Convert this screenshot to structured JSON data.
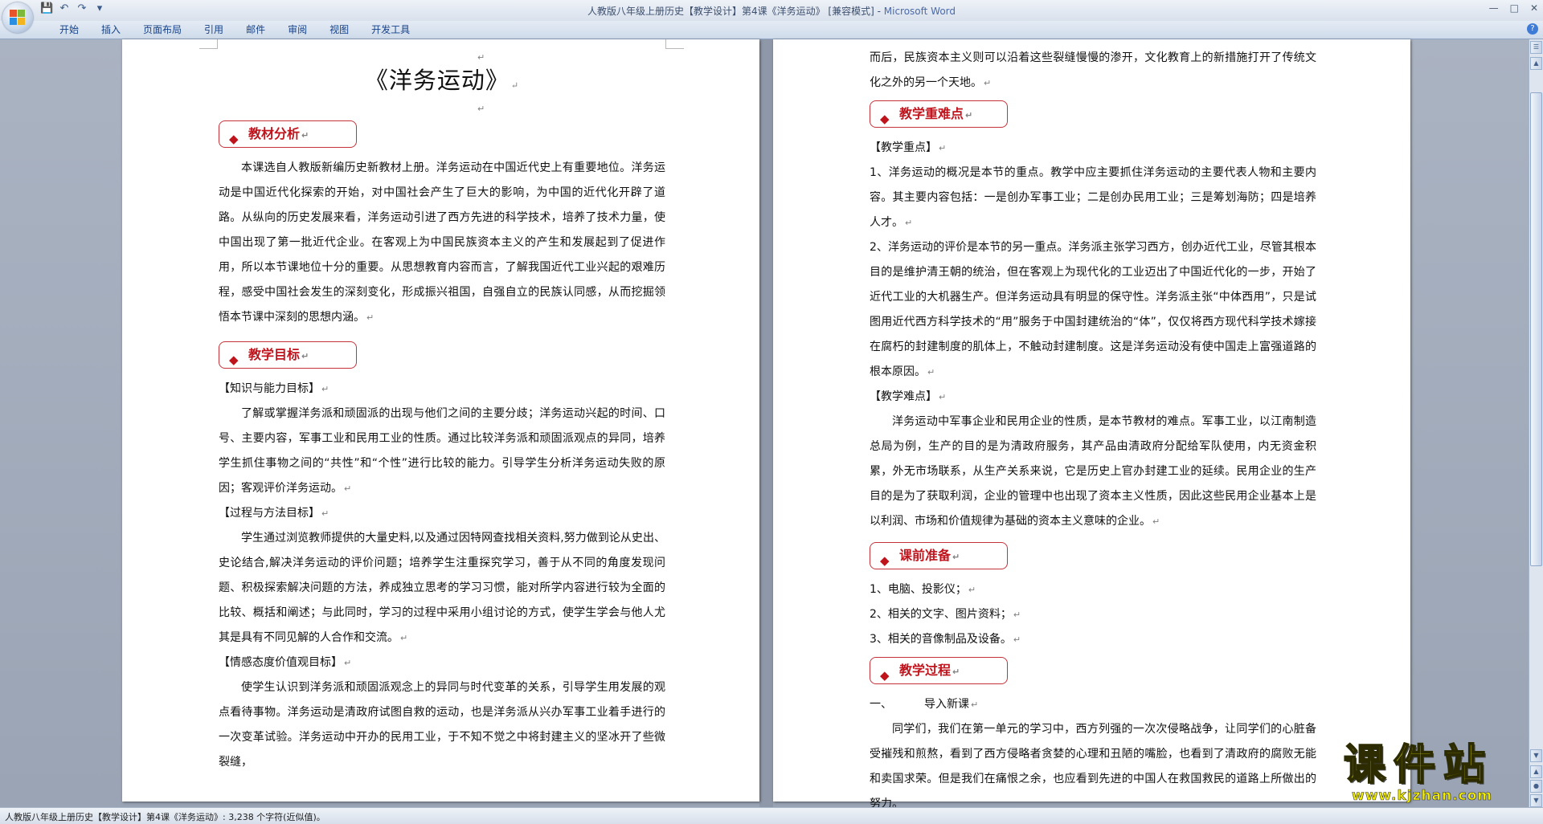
{
  "window": {
    "title_doc": "人教版八年级上册历史【教学设计】第4课《洋务运动》 [兼容模式] - ",
    "title_app": "Microsoft Word"
  },
  "ribbon": {
    "tabs": [
      "开始",
      "插入",
      "页面布局",
      "引用",
      "邮件",
      "审阅",
      "视图",
      "开发工具"
    ]
  },
  "page1": {
    "title": "《洋务运动》",
    "sec1": "教材分析",
    "sec1_body": "本课选自人教版新编历史新教材上册。洋务运动在中国近代史上有重要地位。洋务运动是中国近代化探索的开始，对中国社会产生了巨大的影响，为中国的近代化开辟了道路。从纵向的历史发展来看，洋务运动引进了西方先进的科学技术，培养了技术力量，使中国出现了第一批近代企业。在客观上为中国民族资本主义的产生和发展起到了促进作用，所以本节课地位十分的重要。从思想教育内容而言，了解我国近代工业兴起的艰难历程，感受中国社会发生的深刻变化，形成振兴祖国，自强自立的民族认同感，从而挖掘领悟本节课中深刻的思想内涵。",
    "sec2": "教学目标",
    "goal1_head": "【知识与能力目标】",
    "goal1_body": "了解或掌握洋务派和顽固派的出现与他们之间的主要分歧；洋务运动兴起的时间、口号、主要内容，军事工业和民用工业的性质。通过比较洋务派和顽固派观点的异同，培养学生抓住事物之间的“共性”和“个性”进行比较的能力。引导学生分析洋务运动失败的原因；客观评价洋务运动。",
    "goal2_head": "【过程与方法目标】",
    "goal2_body": "学生通过浏览教师提供的大量史料,以及通过因特网查找相关资料,努力做到论从史出、史论结合,解决洋务运动的评价问题；培养学生注重探究学习，善于从不同的角度发现问题、积极探索解决问题的方法，养成独立思考的学习习惯，能对所学内容进行较为全面的比较、概括和阐述；与此同时，学习的过程中采用小组讨论的方式，使学生学会与他人尤其是具有不同见解的人合作和交流。",
    "goal3_head": "【情感态度价值观目标】",
    "goal3_body": "使学生认识到洋务派和顽固派观念上的异同与时代变革的关系，引导学生用发展的观点看待事物。洋务运动是清政府试图自救的运动，也是洋务派从兴办军事工业着手进行的一次变革试验。洋务运动中开办的民用工业，于不知不觉之中将封建主义的坚冰开了些微裂缝，"
  },
  "page2": {
    "cont": "而后，民族资本主义则可以沿着这些裂缝慢慢的渗开，文化教育上的新措施打开了传统文化之外的另一个天地。",
    "sec3": "教学重难点",
    "key_head": "【教学重点】",
    "key1": "1、洋务运动的概况是本节的重点。教学中应主要抓住洋务运动的主要代表人物和主要内容。其主要内容包括：一是创办军事工业；二是创办民用工业；三是筹划海防；四是培养人才。",
    "key2": "2、洋务运动的评价是本节的另一重点。洋务派主张学习西方，创办近代工业，尽管其根本目的是维护清王朝的统治，但在客观上为现代化的工业迈出了中国近代化的一步，开始了近代工业的大机器生产。但洋务运动具有明显的保守性。洋务派主张“中体西用”，只是试图用近代西方科学技术的“用”服务于中国封建统治的“体”，仅仅将西方现代科学技术嫁接在腐朽的封建制度的肌体上，不触动封建制度。这是洋务运动没有使中国走上富强道路的根本原因。",
    "diff_head": "【教学难点】",
    "diff_body": "洋务运动中军事企业和民用企业的性质，是本节教材的难点。军事工业，以江南制造总局为例，生产的目的是为清政府服务，其产品由清政府分配给军队使用，内无资金积累，外无市场联系，从生产关系来说，它是历史上官办封建工业的延续。民用企业的生产目的是为了获取利润，企业的管理中也出现了资本主义性质，因此这些民用企业基本上是以利润、市场和价值规律为基础的资本主义意味的企业。",
    "sec4": "课前准备",
    "prep": [
      "1、电脑、投影仪；",
      "2、相关的文字、图片资料；",
      "3、相关的音像制品及设备。"
    ],
    "sec5": "教学过程",
    "step1_num": "一、",
    "step1_label": "导入新课",
    "step1_body": "同学们，我们在第一单元的学习中，西方列强的一次次侵略战争，让同学们的心脏备受摧残和煎熬，看到了西方侵略者贪婪的心理和丑陋的嘴脸，也看到了清政府的腐败无能和卖国求荣。但是我们在痛恨之余，也应看到先进的中国人在救国救民的道路上所做出的努力。"
  },
  "statusbar": {
    "text": "人教版八年级上册历史【教学设计】第4课《洋务运动》: 3,238 个字符(近似值)。"
  },
  "watermark": {
    "cn": "课件站",
    "url": "www.kjzhan.com"
  },
  "colors": {
    "heading_red": "#c0141d",
    "ribbon_blue": "#15428b",
    "watermark_yellow": "#f4ef00"
  }
}
